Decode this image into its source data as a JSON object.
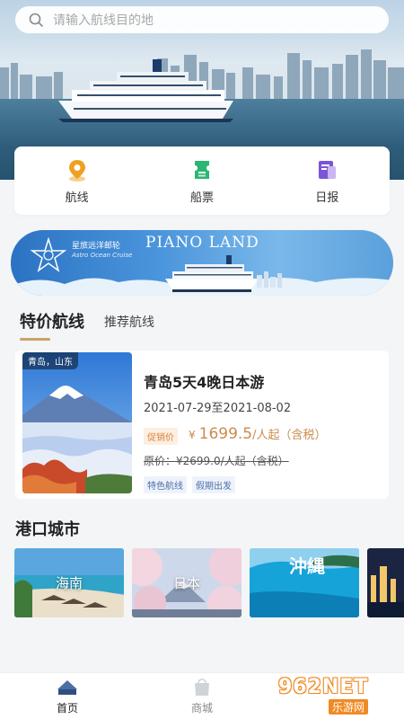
{
  "search": {
    "placeholder": "请输入航线目的地"
  },
  "quick_entries": [
    {
      "label": "航线",
      "icon": "location-pin-icon",
      "color": "#f0a020"
    },
    {
      "label": "船票",
      "icon": "ticket-icon",
      "color": "#2bb673"
    },
    {
      "label": "日报",
      "icon": "newspaper-icon",
      "color": "#7a55d6"
    }
  ],
  "banner": {
    "title": "PIANO LAND",
    "brand_cn": "星旅远洋邮轮",
    "brand_en": "Astro Ocean Cruise"
  },
  "section_tabs": {
    "active": "特价航线",
    "inactive": "推荐航线",
    "accent": "#c9a36a"
  },
  "route_card": {
    "image_tag": "青岛，山东",
    "title": "青岛5天4晚日本游",
    "dates": "2021-07-29至2021-08-02",
    "promo_badge": "促销价",
    "price_symbol": "¥",
    "price_value": "1699.5",
    "price_unit": "/人起（含税）",
    "original_price": "原价：¥2699.0/人起（含税）",
    "tags": [
      "特色航线",
      "假期出发"
    ]
  },
  "cities": {
    "title": "港口城市",
    "items": [
      {
        "label": "海南"
      },
      {
        "label": "日本"
      },
      {
        "label": "沖縄"
      },
      {
        "label": ""
      }
    ]
  },
  "bottom_nav": [
    {
      "label": "首页",
      "icon": "home-ship-icon",
      "active": true
    },
    {
      "label": "商城",
      "icon": "shop-bag-icon",
      "active": false
    }
  ],
  "watermark": {
    "main": "962NET",
    "sub": "乐游网"
  }
}
